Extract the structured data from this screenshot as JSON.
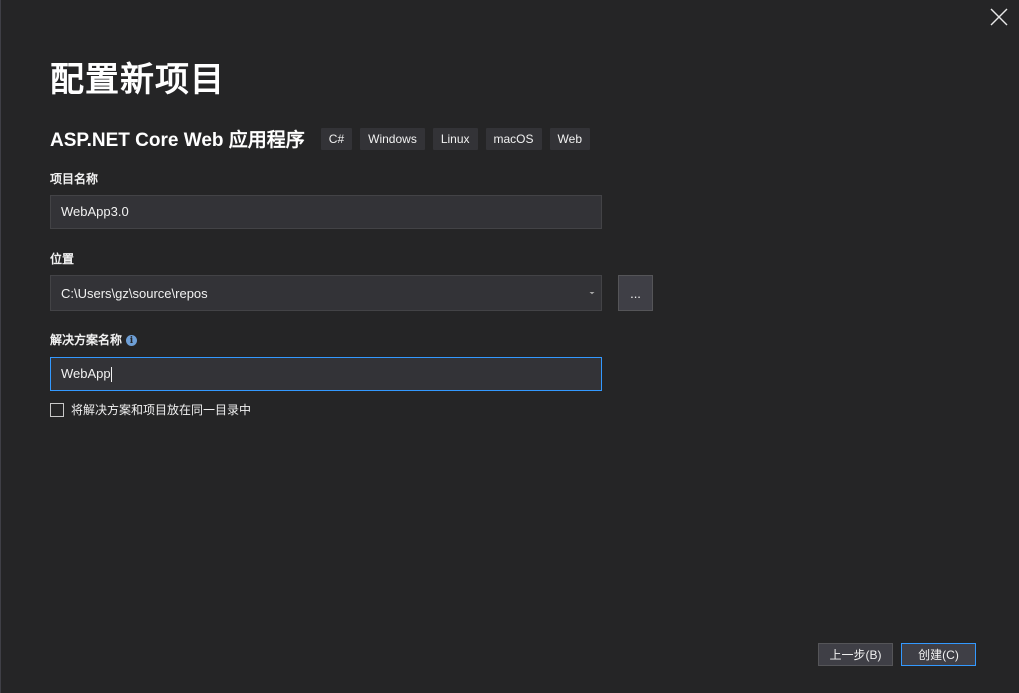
{
  "page": {
    "title": "配置新项目"
  },
  "template": {
    "name": "ASP.NET Core Web 应用程序",
    "tags": [
      "C#",
      "Windows",
      "Linux",
      "macOS",
      "Web"
    ]
  },
  "project_name": {
    "label": "项目名称",
    "value": "WebApp3.0"
  },
  "location": {
    "label": "位置",
    "value": "C:\\Users\\gz\\source\\repos",
    "browse_label": "..."
  },
  "solution_name": {
    "label": "解决方案名称",
    "value": "WebApp",
    "info_icon": "info-icon"
  },
  "same_directory": {
    "label": "将解决方案和项目放在同一目录中",
    "checked": false
  },
  "footer": {
    "back_label": "上一步(B)",
    "create_label": "创建(C)"
  },
  "colors": {
    "background": "#252526",
    "input_background": "#333337",
    "focus_border": "#3399ff",
    "info_icon": "#6e9fd6"
  }
}
